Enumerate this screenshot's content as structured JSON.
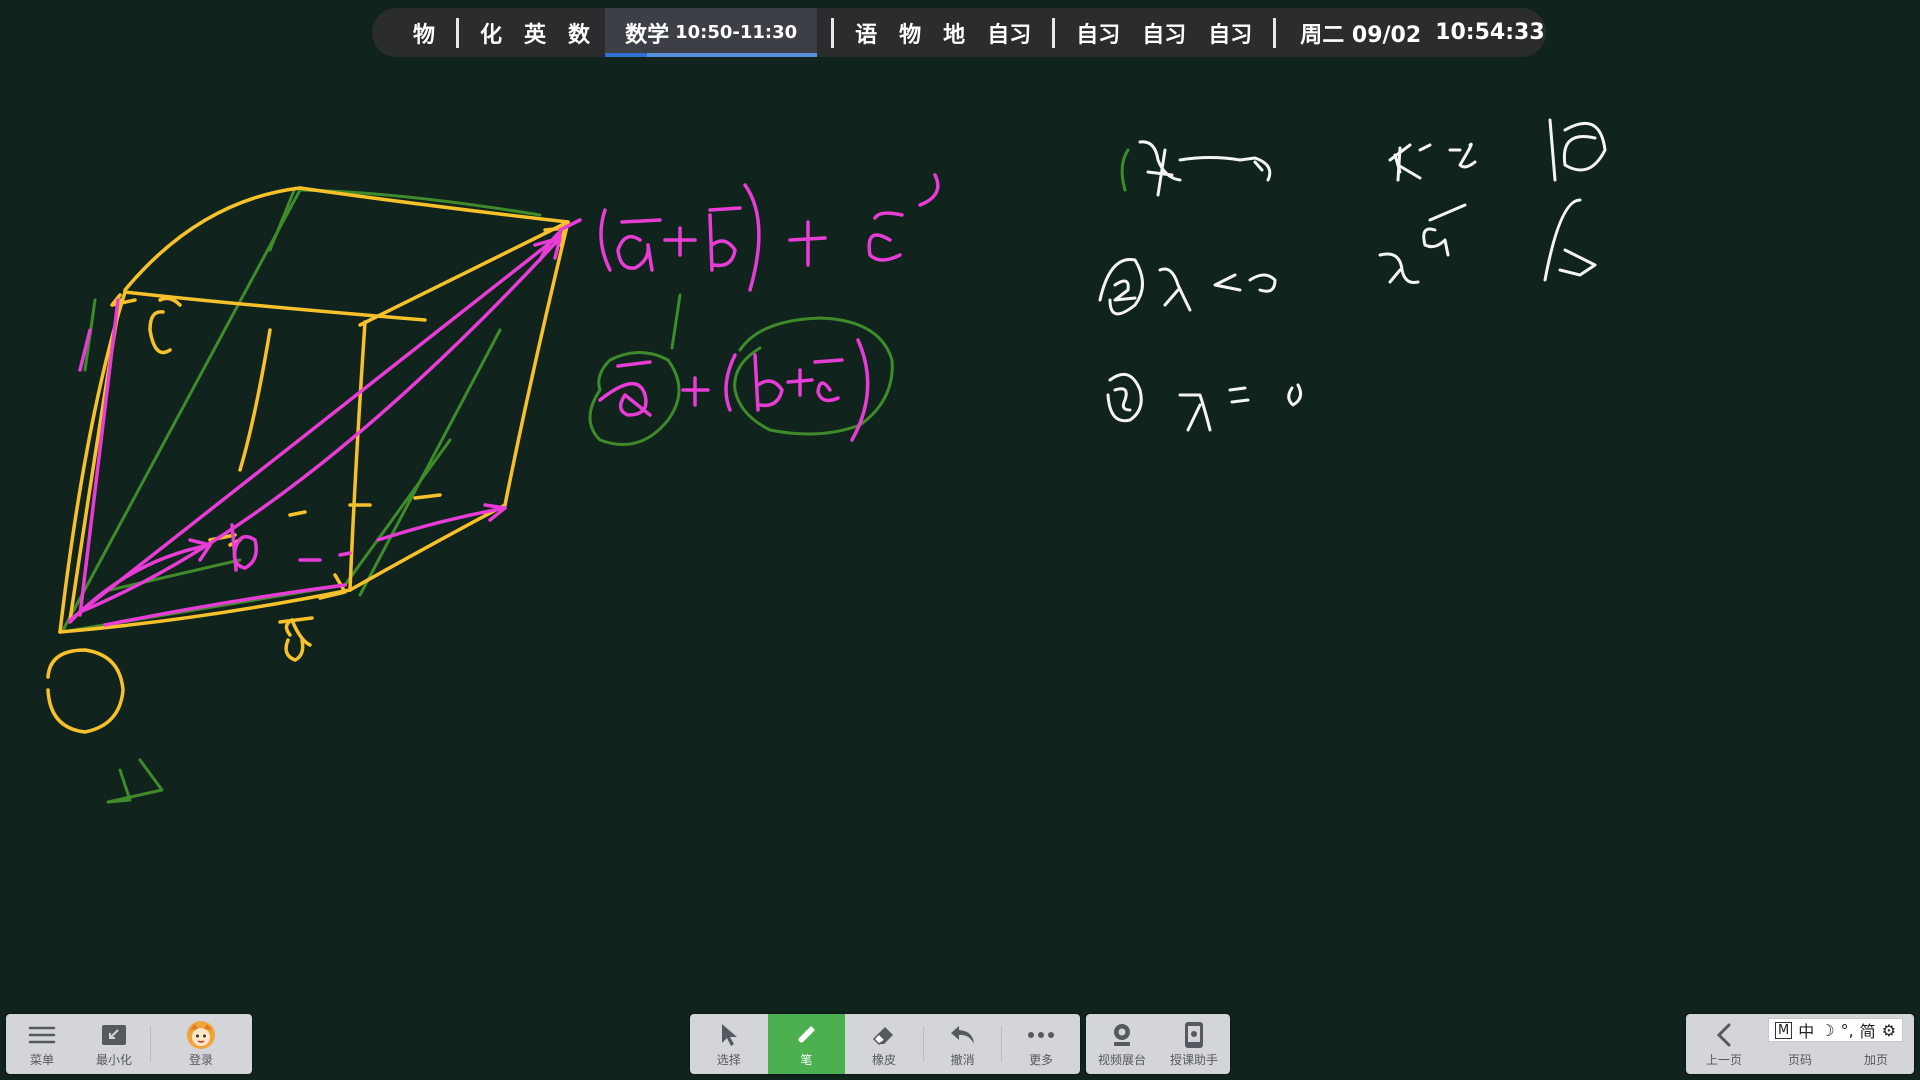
{
  "schedule_bar": {
    "subjects_before": [
      "物",
      "化",
      "英",
      "数"
    ],
    "current": {
      "label": "数学",
      "time": "10:50-11:30",
      "progress": 0.2
    },
    "subjects_after_1": [
      "语",
      "物",
      "地",
      "自习"
    ],
    "subjects_after_2": [
      "自习",
      "自习",
      "自习"
    ],
    "date": "周二 09/02",
    "clock": "10:54:33"
  },
  "left_toolbar": {
    "menu": "菜单",
    "minimize": "最小化",
    "login": "登录"
  },
  "center_toolbar": {
    "select": "选择",
    "pen": "笔",
    "eraser": "橡皮",
    "undo": "撤消",
    "more": "更多"
  },
  "aux_toolbar": {
    "video_booth": "视频展台",
    "teaching_assistant": "授课助手"
  },
  "right_toolbar": {
    "prev_page": "上一页",
    "page_number": "页码",
    "add_page": "加页"
  },
  "ime": {
    "mode": "M",
    "lang": "中",
    "punct": "°,",
    "script": "简"
  },
  "colors": {
    "board": "#11231d",
    "ink_yellow": "#f6c12a",
    "ink_magenta": "#e83cd6",
    "ink_green": "#3f8a2a",
    "ink_white": "#f4f4f4",
    "active_tool": "#4caf50",
    "toolbar": "#d3d5d8"
  }
}
